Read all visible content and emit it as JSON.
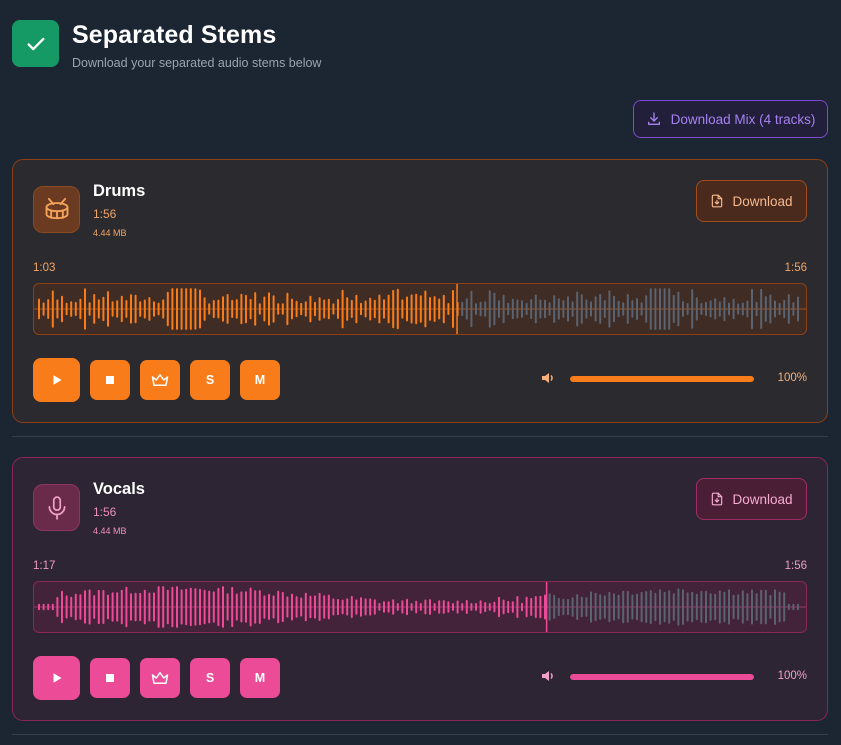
{
  "header": {
    "title": "Separated Stems",
    "subtitle": "Download your separated audio stems below",
    "badge_icon": "check-icon"
  },
  "mix_button": {
    "label": "Download Mix (4 tracks)",
    "icon": "download-icon"
  },
  "colors": {
    "background": "#1c2633",
    "success": "#169a65",
    "mix_accent": "#7b4bd1",
    "drums_accent": "#f97c1b",
    "vocals_accent": "#ec4b97"
  },
  "tracks": [
    {
      "id": "drums",
      "name": "Drums",
      "icon": "drum-icon",
      "duration": "1:56",
      "size": "4.44 MB",
      "download_label": "Download",
      "current_time": "1:03",
      "total_time": "1:56",
      "progress": 0.548,
      "volume_label": "100%",
      "volume": 1.0,
      "controls": {
        "play": "play-icon",
        "stop": "stop-icon",
        "crown": "crown-icon",
        "solo": "S",
        "mute": "M"
      }
    },
    {
      "id": "vocals",
      "name": "Vocals",
      "icon": "microphone-icon",
      "duration": "1:56",
      "size": "4.44 MB",
      "download_label": "Download",
      "current_time": "1:17",
      "total_time": "1:56",
      "progress": 0.664,
      "volume_label": "100%",
      "volume": 1.0,
      "controls": {
        "play": "play-icon",
        "stop": "stop-icon",
        "crown": "crown-icon",
        "solo": "S",
        "mute": "M"
      }
    }
  ]
}
